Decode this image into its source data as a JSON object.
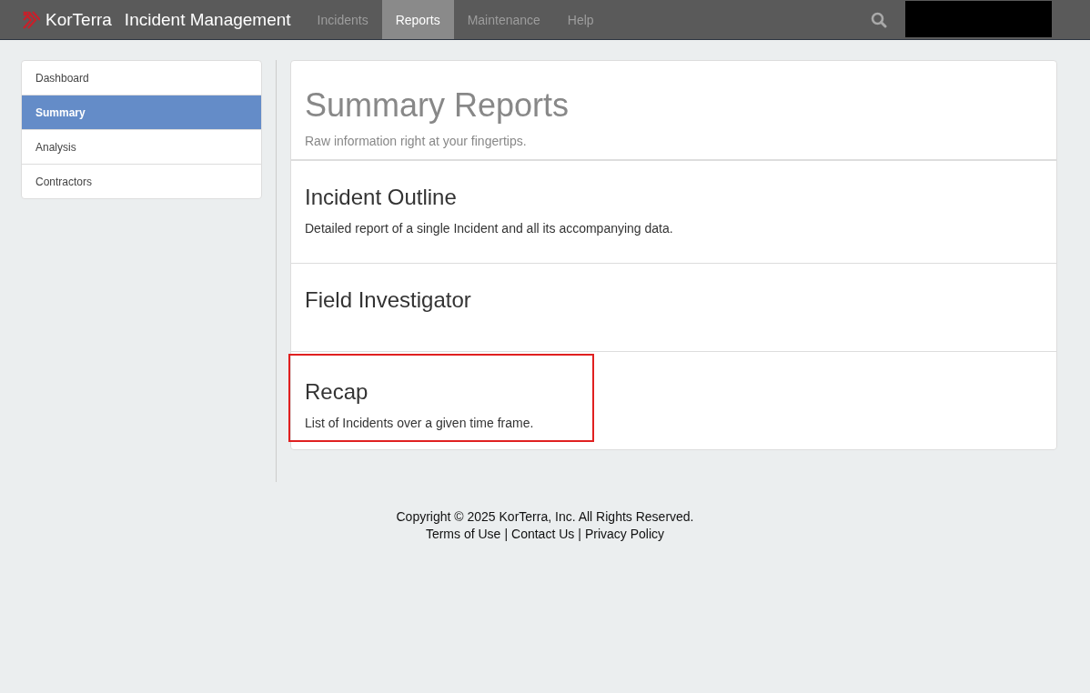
{
  "navbar": {
    "logo_text": "KorTerra",
    "app_title": "Incident Management",
    "tabs": [
      {
        "label": "Incidents",
        "selected": false
      },
      {
        "label": "Reports",
        "selected": true
      },
      {
        "label": "Maintenance",
        "selected": false
      },
      {
        "label": "Help",
        "selected": false
      }
    ]
  },
  "sidebar": {
    "items": [
      {
        "label": "Dashboard",
        "selected": false
      },
      {
        "label": "Summary",
        "selected": true
      },
      {
        "label": "Analysis",
        "selected": false
      },
      {
        "label": "Contractors",
        "selected": false
      }
    ]
  },
  "header": {
    "title": "Summary Reports",
    "subtitle": "Raw information right at your fingertips."
  },
  "reports": [
    {
      "title": "Incident Outline",
      "description": "Detailed report of a single Incident and all its accompanying data.",
      "highlighted": false
    },
    {
      "title": "Field Investigator",
      "highlighted": false
    },
    {
      "title": "Recap",
      "description": "List of Incidents over a given time frame.",
      "highlighted": true
    }
  ],
  "footer": {
    "copyright": "Copyright © 2025 KorTerra, Inc. All Rights Reserved.",
    "links": [
      "Terms of Use",
      "Contact Us",
      "Privacy Policy"
    ],
    "separators": [
      "|",
      "|"
    ]
  }
}
